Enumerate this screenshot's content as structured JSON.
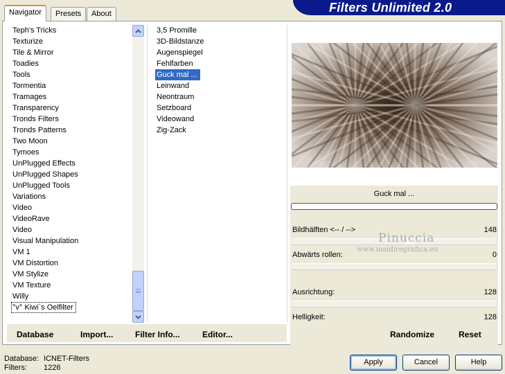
{
  "banner_title": "Filters Unlimited 2.0",
  "tabs": [
    {
      "label": "Navigator",
      "active": true
    },
    {
      "label": "Presets",
      "active": false
    },
    {
      "label": "About",
      "active": false
    }
  ],
  "categories": [
    "Teph's Tricks",
    "Texturize",
    "Tile & Mirror",
    "Toadies",
    "Tools",
    "Tormentia",
    "Tramages",
    "Transparency",
    "Tronds Filters",
    "Tronds Patterns",
    "Two Moon",
    "Tymoes",
    "UnPlugged Effects",
    "UnPlugged Shapes",
    "UnPlugged Tools",
    "Variations",
    "Video",
    "VideoRave",
    "Video",
    "Visual Manipulation",
    "VM 1",
    "VM Distortion",
    "VM Stylize",
    "VM Texture",
    "Willy",
    "°v° Kiwi`s Oelfilter"
  ],
  "selected_category": "°v° Kiwi`s Oelfilter",
  "filters": [
    "3,5 Promille",
    "3D-Bildstanze",
    "Augenspiegel",
    "Fehlfarben",
    "Guck mal ...",
    "Leinwand",
    "Neontraum",
    "Setzboard",
    "Videowand",
    "Zig-Zack"
  ],
  "selected_filter": "Guck mal ...",
  "filter_name": "Guck mal ...",
  "progress": 0,
  "sliders": [
    {
      "label": "Bildhälften <-- / -->",
      "value": "148"
    },
    {
      "label": "Abwärts rollen:",
      "value": "0"
    },
    {
      "label": "Ausrichtung:",
      "value": "128"
    },
    {
      "label": "Helligkeit:",
      "value": "128"
    }
  ],
  "watermark": {
    "name": "Pinuccia",
    "url": "www.maidiregrafica.eu"
  },
  "bottom_links": {
    "database": "Database",
    "import": "Import...",
    "filter_info": "Filter Info...",
    "editor": "Editor...",
    "randomize": "Randomize",
    "reset": "Reset"
  },
  "status": {
    "database_label": "Database:",
    "database_value": "ICNET-Filters",
    "filters_label": "Filters:",
    "filters_value": "1226"
  },
  "buttons": {
    "apply": "Apply",
    "cancel": "Cancel",
    "help": "Help"
  },
  "colors": {
    "selection": "#316ac5",
    "banner": "#0a1a8a",
    "tab_highlight": "#e68b2c"
  }
}
